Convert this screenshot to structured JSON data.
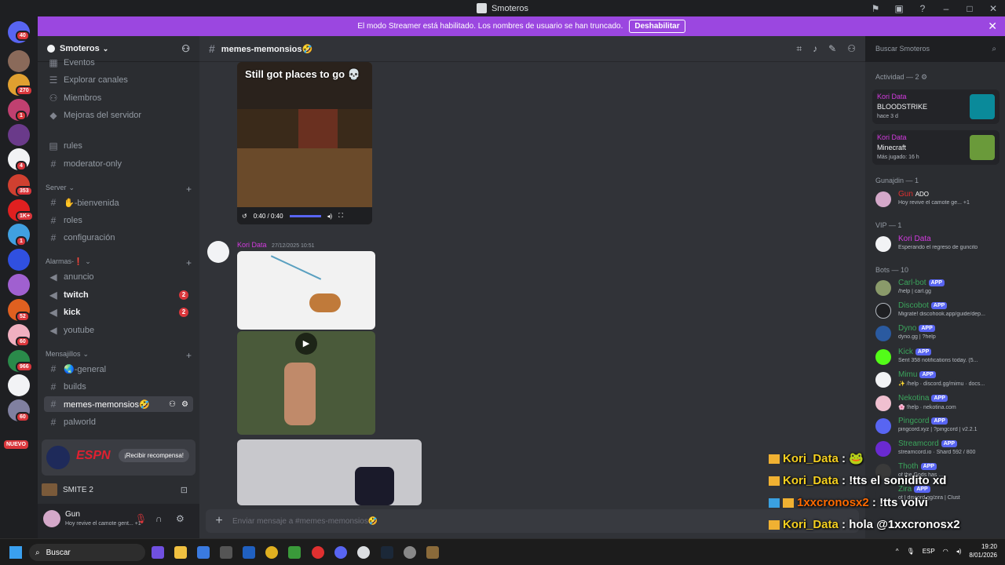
{
  "titlebar": {
    "title": "Smoteros"
  },
  "banner": {
    "text": "El modo Streamer está habilitado. Los nombres de usuario se han truncado.",
    "button": "Deshabilitar"
  },
  "guilds": {
    "badges": [
      "40",
      "270",
      "1",
      "4",
      "353",
      "1K+",
      "1",
      "52",
      "60",
      "966",
      "60"
    ],
    "new_label": "NUEVO"
  },
  "server": {
    "name": "Smoteros"
  },
  "channels": {
    "top": [
      "Eventos",
      "Explorar canales",
      "Miembros",
      "Mejoras del servidor"
    ],
    "ungrouped": [
      "rules",
      "moderator-only"
    ],
    "categories": [
      {
        "name": "Server",
        "channels": [
          "✋-bienvenida",
          "roles",
          "configuración"
        ]
      },
      {
        "name": "Alarmas-❗",
        "channels": [
          "anuncio",
          "twitch",
          "kick",
          "youtube"
        ]
      },
      {
        "name": "Mensajillos",
        "channels": [
          "🌏-general",
          "builds",
          "memes-memonsios🤣",
          "palworld"
        ]
      }
    ],
    "twitch_badge": "2",
    "kick_badge": "2"
  },
  "promo": {
    "brand": "ESPN",
    "button": "¡Recibir recompensa!"
  },
  "activity": {
    "game": "SMITE 2"
  },
  "user": {
    "name": "Gun",
    "status": "Hoy revive el camote gent...",
    "extra": "+1"
  },
  "chat": {
    "channel": "memes-memonsios🤣",
    "video": {
      "caption": "Still got places to go",
      "time": "0:40 / 0:40"
    },
    "message": {
      "author": "Kori Data",
      "timestamp": "27/12/2025 10:51"
    },
    "placeholder": "Enviar mensaje a #memes-memonsios🤣"
  },
  "search": {
    "placeholder": "Buscar Smoteros"
  },
  "members": {
    "activity_header": "Actividad — 2",
    "activity_cards": [
      {
        "user": "Kori Data",
        "game": "BLOODSTRIKE",
        "when": "hace 3 d"
      },
      {
        "user": "Kori Data",
        "game": "Minecraft",
        "when": "Más jugado: 16 h"
      }
    ],
    "gunajdin_header": "Gunajdin — 1",
    "gunajdin": [
      {
        "name": "Gun",
        "tag": "ADO",
        "status": "Hoy revive el camote ge...",
        "extra": "+1"
      }
    ],
    "vip_header": "VIP — 1",
    "vip": [
      {
        "name": "Kori Data",
        "status": "Esperando el regreso de guncito"
      }
    ],
    "bots_header": "Bots — 10",
    "app_tag": "APP",
    "bots": [
      {
        "name": "Carl-bot",
        "status": "/help | carl.gg"
      },
      {
        "name": "Discobot",
        "status": "Migrate! discohook.app/guide/dep..."
      },
      {
        "name": "Dyno",
        "status": "dyno.gg | ?help"
      },
      {
        "name": "Kick",
        "status": "Sent 358 notifications today. (5..."
      },
      {
        "name": "Mimu",
        "status": "✨ /help · discord.gg/mimu · docs..."
      },
      {
        "name": "Nekotina",
        "status": "🌸 !help · nekotina.com"
      },
      {
        "name": "Pingcord",
        "status": "pingcord.xyz | ?pingcord | v2.2.1"
      },
      {
        "name": "Streamcord",
        "status": "streamcord.io · Shard 592 / 800"
      },
      {
        "name": "Thoth",
        "status": "of the Gods has ..."
      },
      {
        "name": "Zira",
        "status": "ot | discord.gg/zira | Clust"
      }
    ]
  },
  "overlay": {
    "lines": [
      {
        "user": "Kori_Data",
        "text": " :"
      },
      {
        "user": "Kori_Data",
        "text": " : !tts el sonidito xd"
      },
      {
        "user": "1xxcronosx2",
        "text": " : !tts volvi"
      },
      {
        "user": "Kori_Data",
        "text": " : hola @1xxcronosx2"
      }
    ]
  },
  "taskbar": {
    "search": "Buscar",
    "lang": "ESP",
    "time": "19:20",
    "date": "8/01/2026"
  }
}
